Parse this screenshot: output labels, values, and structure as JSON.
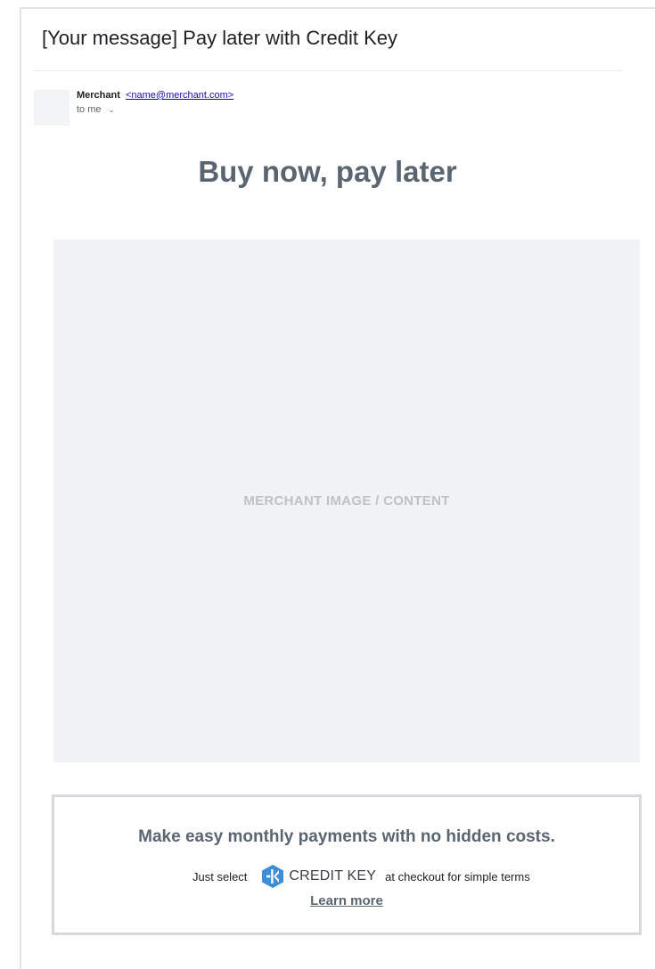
{
  "email": {
    "subject": "[Your message] Pay later with Credit Key",
    "sender_name": "Merchant",
    "sender_email": "<name@merchant.com>",
    "recipient": "to me",
    "chevron_icon": "chevron-down-icon"
  },
  "content": {
    "headline": "Buy now, pay later",
    "image_placeholder": "MERCHANT IMAGE / CONTENT"
  },
  "promo": {
    "heading": "Make easy monthly payments with no hidden costs.",
    "prefix": "Just select",
    "brand_name": "CREDIT KEY",
    "suffix": "at checkout for simple terms",
    "learn_more": "Learn more",
    "brand_icon": "credit-key-logo-icon",
    "brand_color": "#3b8fd9"
  },
  "colors": {
    "headline": "#5a6570",
    "placeholder_bg": "#f1f2f4",
    "placeholder_text": "#bcc2c8",
    "link": "#1a0dab",
    "promo_border": "#d5d9dd"
  }
}
